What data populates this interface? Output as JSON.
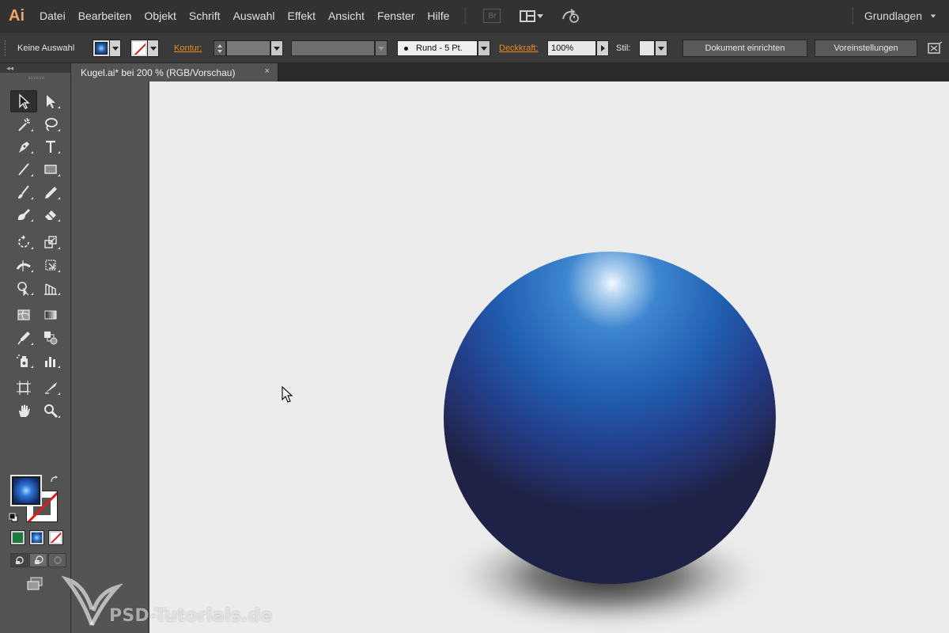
{
  "app": {
    "logo": "Ai",
    "menu": [
      "Datei",
      "Bearbeiten",
      "Objekt",
      "Schrift",
      "Auswahl",
      "Effekt",
      "Ansicht",
      "Fenster",
      "Hilfe"
    ],
    "bridge_label": "Br",
    "workspace": "Grundlagen"
  },
  "control_bar": {
    "selection_status": "Keine Auswahl",
    "stroke_label": "Kontur:",
    "brush": "Rund - 5 Pt.",
    "opacity_label": "Deckkraft:",
    "opacity_value": "100%",
    "style_label": "Stil:",
    "document_setup_button": "Dokument einrichten",
    "preferences_button": "Voreinstellungen"
  },
  "document": {
    "tab_title": "Kugel.ai* bei 200 % (RGB/Vorschau)",
    "close_glyph": "×",
    "zoom_percent": 200,
    "color_mode": "RGB"
  },
  "tools_panel": {
    "collapse_glyph": "◂◂",
    "tools": [
      [
        "selection-tool",
        "direct-selection-tool"
      ],
      [
        "magic-wand-tool",
        "lasso-tool"
      ],
      [
        "pen-tool",
        "type-tool"
      ],
      [
        "line-segment-tool",
        "rectangle-tool"
      ],
      [
        "paintbrush-tool",
        "pencil-tool"
      ],
      [
        "blob-brush-tool",
        "eraser-tool"
      ],
      [
        "rotate-tool",
        "scale-tool"
      ],
      [
        "width-tool",
        "free-transform-tool"
      ],
      [
        "shape-builder-tool",
        "perspective-grid-tool"
      ],
      [
        "mesh-tool",
        "gradient-tool"
      ],
      [
        "eyedropper-tool",
        "blend-tool"
      ],
      [
        "symbol-sprayer-tool",
        "column-graph-tool"
      ],
      [
        "artboard-tool",
        "slice-tool"
      ],
      [
        "hand-tool",
        "zoom-tool"
      ]
    ],
    "active_tool": "selection-tool",
    "fill_type": "radial-gradient",
    "stroke_type": "none"
  },
  "colors": {
    "ui_dark": "#323232",
    "ui_panel": "#535353",
    "accent_orange": "#e88a22",
    "artboard": "#ececec",
    "sphere_highlight": "#d8ecff",
    "sphere_mid": "#2d6cc4",
    "sphere_dark": "#1c2350"
  },
  "watermark": {
    "text": "PSD-Tutorials.de"
  }
}
